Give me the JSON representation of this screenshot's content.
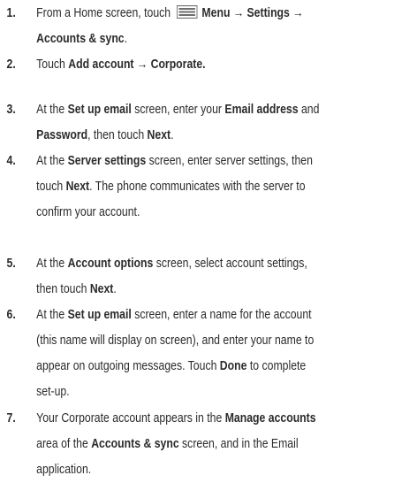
{
  "steps": [
    {
      "number": "1.",
      "lines": [
        [
          "From a Home screen, touch ",
          {
            "icon": "menu-icon"
          },
          {
            "b": "Menu → Settings →"
          }
        ],
        [
          {
            "b": "Accounts & sync"
          },
          "."
        ]
      ]
    },
    {
      "number": "2.",
      "lines": [
        [
          "Touch ",
          {
            "b": "Add account → Corporate."
          }
        ]
      ]
    },
    {
      "number": "3.",
      "lines": [
        [
          "At the ",
          {
            "b": "Set up email"
          },
          " screen, enter your ",
          {
            "b": "Email address"
          },
          " and"
        ],
        [
          {
            "b": "Password"
          },
          ", then touch ",
          {
            "b": "Next"
          },
          "."
        ]
      ]
    },
    {
      "number": "4.",
      "lines": [
        [
          "At the ",
          {
            "b": "Server settings"
          },
          " screen, enter server settings, then"
        ],
        [
          "touch ",
          {
            "b": "Next"
          },
          ". The phone communicates with the server to"
        ],
        [
          "confirm your account."
        ]
      ]
    },
    {
      "number": "5.",
      "lines": [
        [
          "At the ",
          {
            "b": "Account options"
          },
          " screen, select account settings,"
        ],
        [
          "then touch ",
          {
            "b": "Next"
          },
          "."
        ]
      ]
    },
    {
      "number": "6.",
      "lines": [
        [
          "At the ",
          {
            "b": "Set up email"
          },
          " screen, enter a name for the account"
        ],
        [
          "(this name will display on screen), and enter your name to"
        ],
        [
          "appear on outgoing messages. Touch ",
          {
            "b": "Done"
          },
          " to complete"
        ],
        [
          "set-up."
        ]
      ]
    },
    {
      "number": "7.",
      "lines": [
        [
          "Your Corporate account appears in the ",
          {
            "b": "Manage accounts"
          }
        ],
        [
          "area of the ",
          {
            "b": "Accounts & sync"
          },
          " screen, and in the Email"
        ],
        [
          "application."
        ]
      ]
    }
  ],
  "colors": {
    "text": "#2b2b2b",
    "icon": "#6e6e6e"
  }
}
